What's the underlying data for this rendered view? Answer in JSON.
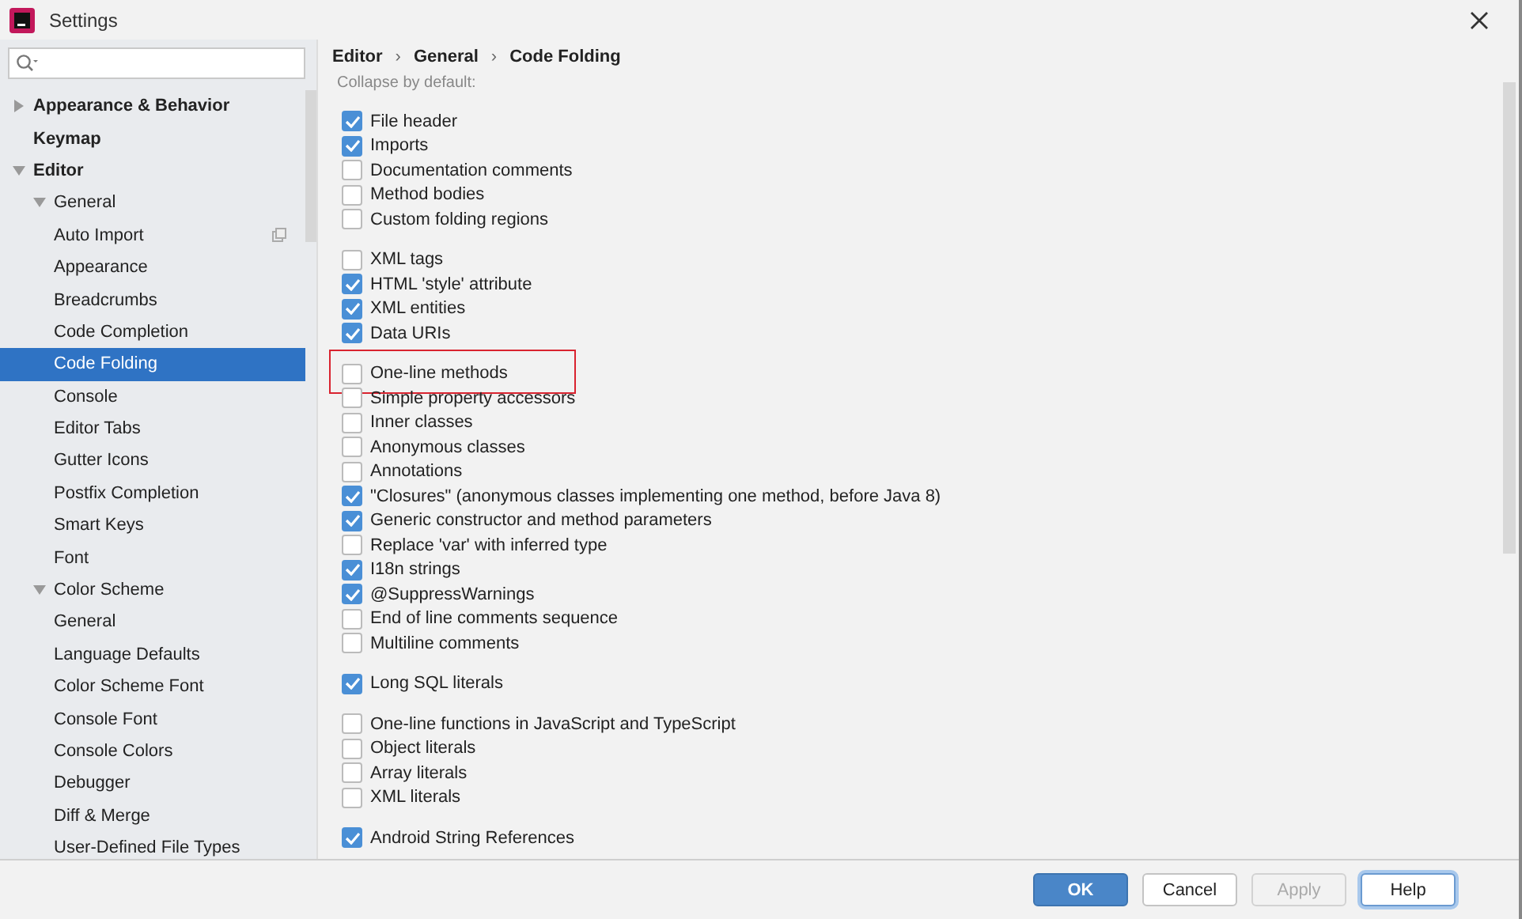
{
  "window": {
    "title": "Settings"
  },
  "sidebar": {
    "tree": [
      {
        "label": "Appearance & Behavior",
        "bold": true,
        "expanded": false
      },
      {
        "label": "Keymap",
        "bold": true
      },
      {
        "label": "Editor",
        "bold": true,
        "expanded": true,
        "children": [
          {
            "label": "General",
            "bold": false,
            "expanded": true,
            "children": [
              {
                "label": "Auto Import",
                "selected": false,
                "scoped": true
              },
              {
                "label": "Appearance",
                "selected": false,
                "scoped": false
              },
              {
                "label": "Breadcrumbs",
                "selected": false,
                "scoped": false
              },
              {
                "label": "Code Completion",
                "selected": false,
                "scoped": false
              },
              {
                "label": "Code Folding",
                "selected": true,
                "scoped": false
              },
              {
                "label": "Console",
                "selected": false,
                "scoped": false
              },
              {
                "label": "Editor Tabs",
                "selected": false,
                "scoped": false
              },
              {
                "label": "Gutter Icons",
                "selected": false,
                "scoped": false
              },
              {
                "label": "Postfix Completion",
                "selected": false,
                "scoped": false
              },
              {
                "label": "Smart Keys",
                "selected": false,
                "scoped": false
              }
            ]
          },
          {
            "label": "Font",
            "bold": false
          },
          {
            "label": "Color Scheme",
            "bold": false,
            "expanded": true,
            "children": [
              {
                "label": "General",
                "selected": false,
                "scoped": false
              },
              {
                "label": "Language Defaults",
                "selected": false,
                "scoped": false
              },
              {
                "label": "Color Scheme Font",
                "selected": false,
                "scoped": false
              },
              {
                "label": "Console Font",
                "selected": false,
                "scoped": false
              },
              {
                "label": "Console Colors",
                "selected": false,
                "scoped": false
              },
              {
                "label": "Debugger",
                "selected": false,
                "scoped": false
              },
              {
                "label": "Diff & Merge",
                "selected": false,
                "scoped": false
              },
              {
                "label": "User-Defined File Types",
                "selected": false,
                "scoped": false
              }
            ]
          }
        ]
      }
    ]
  },
  "breadcrumb": [
    "Editor",
    "General",
    "Code Folding"
  ],
  "breadcrumb_separator": "›",
  "section_label": "Collapse by default:",
  "groups": [
    {
      "items": [
        {
          "label": "File header",
          "checked": true,
          "highlighted": false
        },
        {
          "label": "Imports",
          "checked": true,
          "highlighted": false
        },
        {
          "label": "Documentation comments",
          "checked": false,
          "highlighted": false
        },
        {
          "label": "Method bodies",
          "checked": false,
          "highlighted": false
        },
        {
          "label": "Custom folding regions",
          "checked": false,
          "highlighted": false
        }
      ]
    },
    {
      "items": [
        {
          "label": "XML tags",
          "checked": false,
          "highlighted": false
        },
        {
          "label": "HTML 'style' attribute",
          "checked": true,
          "highlighted": false
        },
        {
          "label": "XML entities",
          "checked": true,
          "highlighted": false
        },
        {
          "label": "Data URIs",
          "checked": true,
          "highlighted": false
        }
      ]
    },
    {
      "items": [
        {
          "label": "One-line methods",
          "checked": false,
          "highlighted": true
        },
        {
          "label": "Simple property accessors",
          "checked": false,
          "highlighted": false
        },
        {
          "label": "Inner classes",
          "checked": false,
          "highlighted": false
        },
        {
          "label": "Anonymous classes",
          "checked": false,
          "highlighted": false
        },
        {
          "label": "Annotations",
          "checked": false,
          "highlighted": false
        },
        {
          "label": "\"Closures\" (anonymous classes implementing one method, before Java 8)",
          "checked": true,
          "highlighted": false
        },
        {
          "label": "Generic constructor and method parameters",
          "checked": true,
          "highlighted": false
        },
        {
          "label": "Replace 'var' with inferred type",
          "checked": false,
          "highlighted": false
        },
        {
          "label": "I18n strings",
          "checked": true,
          "highlighted": false
        },
        {
          "label": "@SuppressWarnings",
          "checked": true,
          "highlighted": false
        },
        {
          "label": "End of line comments sequence",
          "checked": false,
          "highlighted": false
        },
        {
          "label": "Multiline comments",
          "checked": false,
          "highlighted": false
        }
      ]
    },
    {
      "items": [
        {
          "label": "Long SQL literals",
          "checked": true,
          "highlighted": false
        }
      ]
    },
    {
      "items": [
        {
          "label": "One-line functions in JavaScript and TypeScript",
          "checked": false,
          "highlighted": false
        },
        {
          "label": "Object literals",
          "checked": false,
          "highlighted": false
        },
        {
          "label": "Array literals",
          "checked": false,
          "highlighted": false
        },
        {
          "label": "XML literals",
          "checked": false,
          "highlighted": false
        }
      ]
    },
    {
      "items": [
        {
          "label": "Android String References",
          "checked": true,
          "highlighted": false
        }
      ]
    }
  ],
  "buttons": [
    {
      "label": "OK",
      "kind": "primary"
    },
    {
      "label": "Cancel",
      "kind": "normal"
    },
    {
      "label": "Apply",
      "kind": "disabled"
    },
    {
      "label": "Help",
      "kind": "focused"
    }
  ]
}
